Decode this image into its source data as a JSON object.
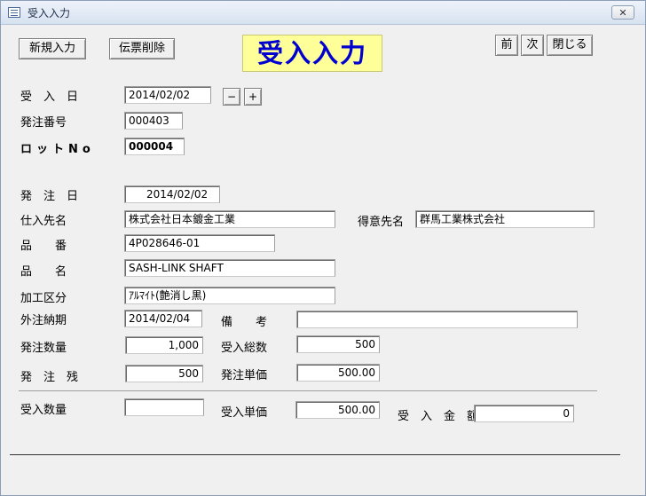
{
  "window": {
    "title": "受入入力",
    "close_label": "✕"
  },
  "toolbar": {
    "new_label": "新規入力",
    "delete_label": "伝票削除",
    "prev_label": "前",
    "next_label": "次",
    "close_label": "閉じる"
  },
  "banner": {
    "title": "受入入力"
  },
  "form": {
    "receipt_date": {
      "label": "受　入　日",
      "value": "2014/02/02",
      "minus": "−",
      "plus": "+"
    },
    "order_no": {
      "label": "発注番号",
      "value": "000403"
    },
    "lot_no": {
      "label": "ロットNo",
      "value": "000004"
    },
    "order_date": {
      "label": "発　注　日",
      "value": "2014/02/02"
    },
    "supplier": {
      "label": "仕入先名",
      "value": "株式会社日本鍍金工業"
    },
    "customer": {
      "label": "得意先名",
      "value": "群馬工業株式会社"
    },
    "part_no": {
      "label": "品　　番",
      "value": "4P028646-01"
    },
    "part_name": {
      "label": "品　　名",
      "value": "SASH-LINK SHAFT"
    },
    "process": {
      "label": "加工区分",
      "value": "ｱﾙﾏｲﾄ(艶消し黒)"
    },
    "due_date": {
      "label": "外注納期",
      "value": "2014/02/04"
    },
    "remarks": {
      "label": "備　　考",
      "value": ""
    },
    "order_qty": {
      "label": "発注数量",
      "value": "1,000"
    },
    "received_total": {
      "label": "受入総数",
      "value": "500"
    },
    "order_remaining": {
      "label": "発　注　残",
      "value": "500"
    },
    "order_unit_price": {
      "label": "発注単価",
      "value": "500.00"
    },
    "received_qty": {
      "label": "受入数量",
      "value": ""
    },
    "received_unit_price": {
      "label": "受入単価",
      "value": "500.00"
    },
    "received_amount": {
      "label": "受　入　金　額",
      "value": "0"
    }
  }
}
